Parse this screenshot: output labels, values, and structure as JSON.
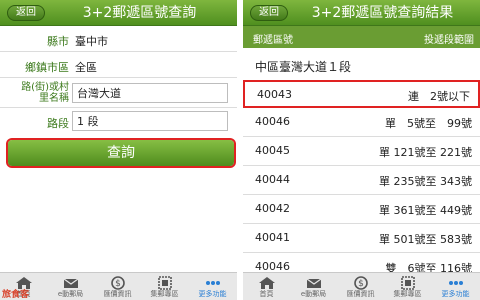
{
  "left": {
    "header": {
      "back_label": "返回",
      "title": "3+2郵遞區號查詢"
    },
    "form": {
      "city_label": "縣市",
      "city_value": "臺中市",
      "district_label": "鄉鎮市區",
      "district_value": "全區",
      "road_label": "路(街)或村里名稱",
      "road_value": "台灣大道",
      "section_label": "路段",
      "section_value": "1 段",
      "query_button": "查詢"
    },
    "tabs": [
      {
        "label": "首頁",
        "icon": "home-icon"
      },
      {
        "label": "e動郵局",
        "icon": "post-icon"
      },
      {
        "label": "匯價資訊",
        "icon": "dollar-icon"
      },
      {
        "label": "集郵專區",
        "icon": "stamp-icon"
      },
      {
        "label": "更多功能",
        "icon": "more-icon"
      }
    ],
    "watermark": "旅食客"
  },
  "right": {
    "header": {
      "back_label": "返回",
      "title": "3+2郵遞區號查詢結果"
    },
    "columns": {
      "code": "郵遞區號",
      "range": "投遞段範圍"
    },
    "road_title": "中區臺灣大道１段",
    "rows": [
      {
        "code": "40043",
        "range": "連　2號以下",
        "highlighted": true
      },
      {
        "code": "40046",
        "range": "單　5號至　99號",
        "highlighted": false
      },
      {
        "code": "40045",
        "range": "單 121號至 221號",
        "highlighted": false
      },
      {
        "code": "40044",
        "range": "單 235號至 343號",
        "highlighted": false
      },
      {
        "code": "40042",
        "range": "單 361號至 449號",
        "highlighted": false
      },
      {
        "code": "40041",
        "range": "單 501號至 583號",
        "highlighted": false
      },
      {
        "code": "40046",
        "range": "雙　6號至 116號",
        "highlighted": false
      }
    ],
    "tabs": [
      {
        "label": "首頁",
        "icon": "home-icon"
      },
      {
        "label": "e動郵局",
        "icon": "post-icon"
      },
      {
        "label": "匯價資訊",
        "icon": "dollar-icon"
      },
      {
        "label": "集郵專區",
        "icon": "stamp-icon"
      },
      {
        "label": "更多功能",
        "icon": "more-icon"
      }
    ]
  },
  "colors": {
    "brand_green": "#5a9a28",
    "highlight_red": "#e02222"
  }
}
